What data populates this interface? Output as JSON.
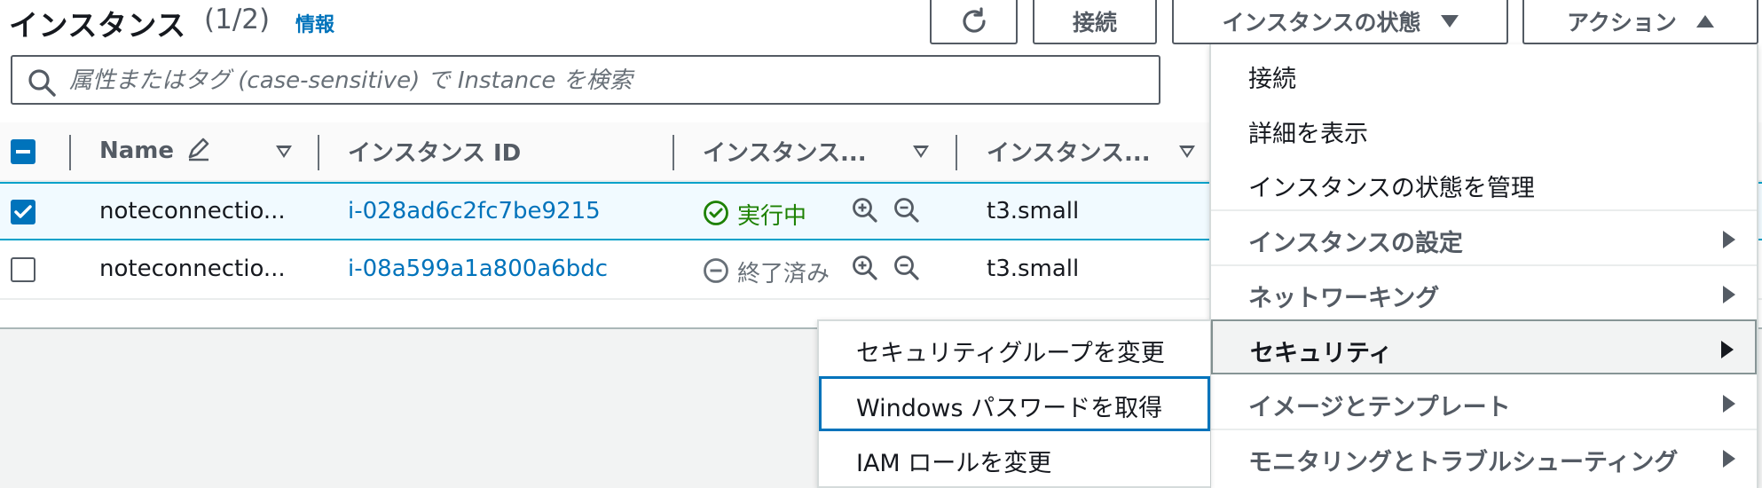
{
  "header": {
    "title": "インスタンス",
    "count": "(1/2)",
    "info_link": "情報",
    "refresh_icon": "refresh-icon",
    "connect_label": "接続",
    "state_label": "インスタンスの状態",
    "actions_label": "アクション"
  },
  "search": {
    "placeholder": "属性またはタグ (case-sensitive) で Instance を検索"
  },
  "table": {
    "columns": [
      "Name",
      "インスタンス ID",
      "インスタンス...",
      "インスタンス..."
    ],
    "rows": [
      {
        "name": "noteconnectio...",
        "id": "i-028ad6c2fc7be9215",
        "state": "実行中",
        "type": "t3.small",
        "checked": true
      },
      {
        "name": "noteconnectio...",
        "id": "i-08a599a1a800a6bdc",
        "state": "終了済み",
        "type": "t3.small",
        "checked": false
      }
    ]
  },
  "actions_menu": {
    "items": [
      {
        "label": "接続",
        "submenu": false
      },
      {
        "label": "詳細を表示",
        "submenu": false
      },
      {
        "label": "インスタンスの状態を管理",
        "submenu": false
      },
      {
        "label": "インスタンスの設定",
        "submenu": true
      },
      {
        "label": "ネットワーキング",
        "submenu": true
      },
      {
        "label": "セキュリティ",
        "submenu": true,
        "active": true
      },
      {
        "label": "イメージとテンプレート",
        "submenu": true
      },
      {
        "label": "モニタリングとトラブルシューティング",
        "submenu": true
      }
    ]
  },
  "security_submenu": {
    "items": [
      {
        "label": "セキュリティグループを変更"
      },
      {
        "label": "Windows パスワードを取得",
        "focused": true
      },
      {
        "label": "IAM ロールを変更"
      }
    ]
  },
  "colors": {
    "link": "#0073bb",
    "running": "#1d8102",
    "terminated": "#687078",
    "selected_row": "#f1faff"
  }
}
